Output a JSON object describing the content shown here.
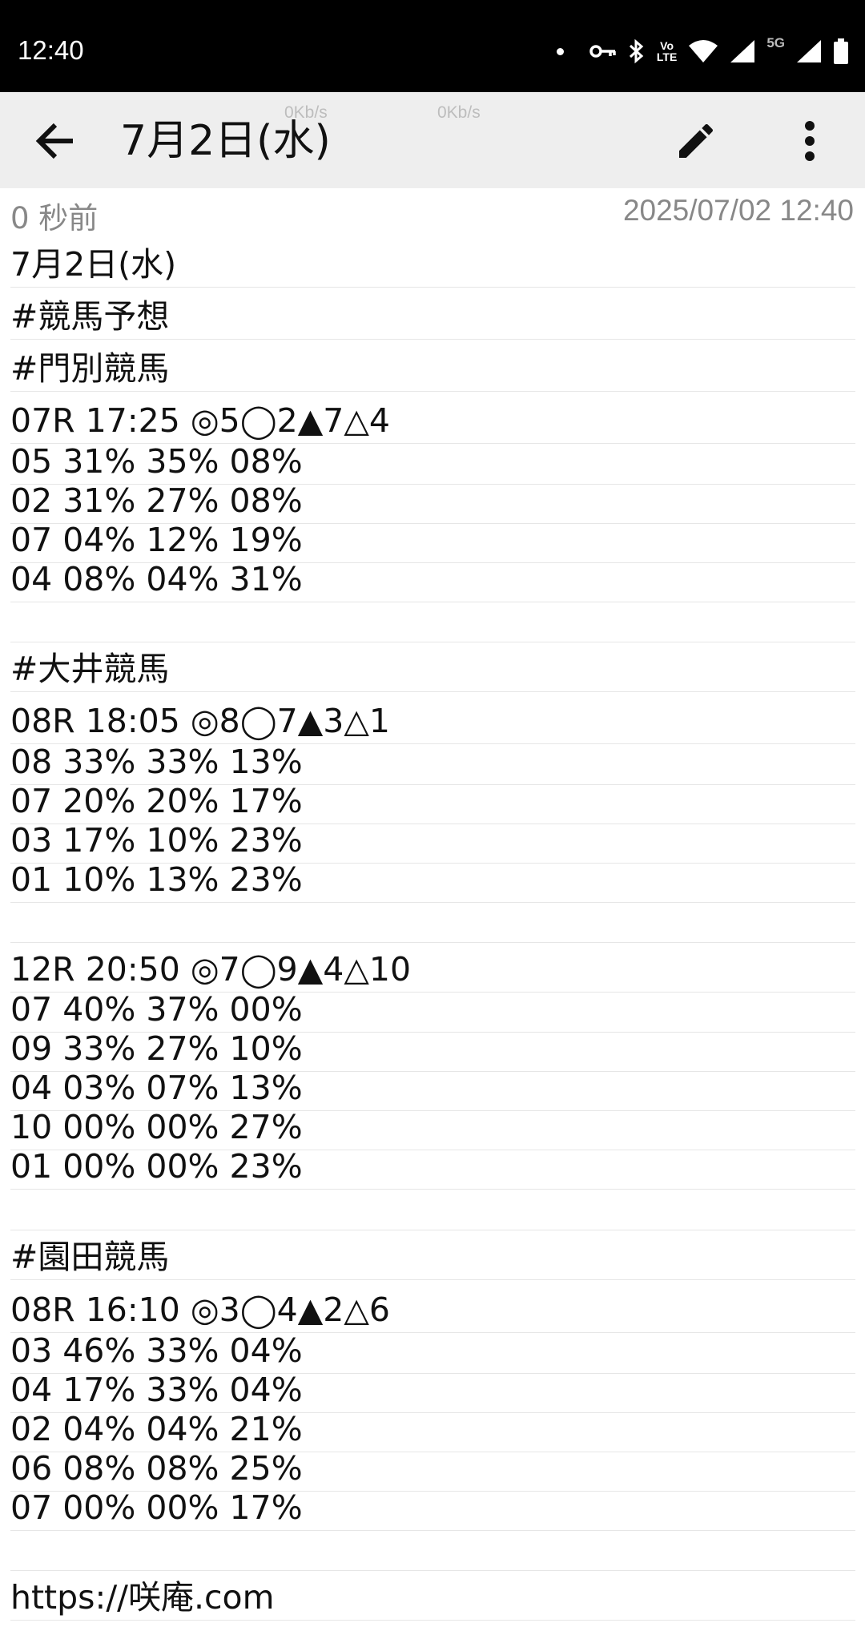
{
  "status_bar": {
    "time": "12:40",
    "icons": [
      "notification-dot-icon",
      "vpn-key-icon",
      "bluetooth-icon",
      "volte-icon",
      "wifi-icon",
      "signal-icon",
      "5g-signal-icon",
      "battery-icon"
    ],
    "volte_label_1": "Vo",
    "volte_label_2": "LTE",
    "network_label": "5G"
  },
  "toolbar": {
    "title": "7月2日(水)",
    "speed_1": "0Kb/s",
    "speed_2": "0Kb/s",
    "back_icon": "arrow-back-icon",
    "edit_icon": "pencil-icon",
    "more_icon": "more-vert-icon"
  },
  "meta": {
    "relative_time": "0 秒前",
    "timestamp": "2025/07/02 12:40"
  },
  "note_lines": [
    "7月2日(水)",
    "#競馬予想",
    "#門別競馬",
    "07R 17:25 ◎5◯2▲7△4",
    "05 31% 35% 08%",
    "02 31% 27% 08%",
    "07 04% 12% 19%",
    "04 08% 04% 31%",
    "",
    "#大井競馬",
    "08R 18:05 ◎8◯7▲3△1",
    "08 33% 33% 13%",
    "07 20% 20% 17%",
    "03 17% 10% 23%",
    "01 10% 13% 23%",
    "",
    "12R 20:50 ◎7◯9▲4△10",
    "07 40% 37% 00%",
    "09 33% 27% 10%",
    "04 03% 07% 13%",
    "10 00% 00% 27%",
    "01 00% 00% 23%",
    "",
    "#園田競馬",
    "08R 16:10 ◎3◯4▲2△6",
    "03 46% 33% 04%",
    "04 17% 33% 04%",
    "02 04% 04% 21%",
    "06 08% 08% 25%",
    "07 00% 00% 17%",
    "",
    "https://咲庵.com"
  ]
}
